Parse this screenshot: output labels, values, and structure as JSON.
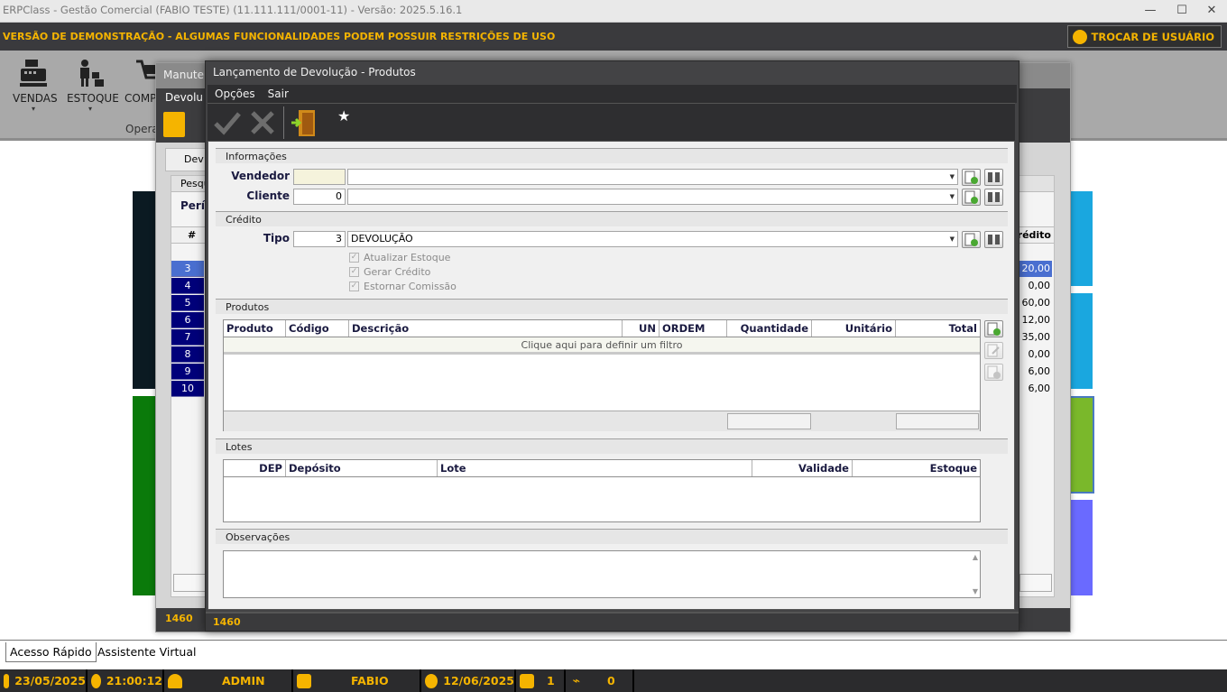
{
  "window": {
    "title": "ERPClass - Gestão Comercial (FABIO TESTE) (11.111.111/0001-11) - Versão: 2025.5.16.1"
  },
  "demo_banner": {
    "message": "VERSÃO DE DEMONSTRAÇÃO - ALGUMAS FUNCIONALIDADES PODEM POSSUIR RESTRIÇÕES DE USO",
    "switch_user": "TROCAR DE USUÁRIO"
  },
  "ribbon": {
    "buttons": [
      {
        "label": "VENDAS"
      },
      {
        "label": "ESTOQUE"
      },
      {
        "label": "COMP"
      }
    ],
    "group_label": "Opera"
  },
  "background_window": {
    "caption": "Manute",
    "menu": "Devolu",
    "tab": "Dev",
    "search_label": "Pesqu",
    "period_label": "Perío",
    "hash_header": "#",
    "credit_header": "rédito",
    "rows": [
      {
        "num": "3",
        "credit": "20,00"
      },
      {
        "num": "4",
        "credit": "0,00"
      },
      {
        "num": "5",
        "credit": "60,00"
      },
      {
        "num": "6",
        "credit": "12,00"
      },
      {
        "num": "7",
        "credit": "35,00"
      },
      {
        "num": "8",
        "credit": "0,00"
      },
      {
        "num": "9",
        "credit": "6,00"
      },
      {
        "num": "10",
        "credit": "6,00"
      }
    ],
    "status": "1460"
  },
  "modal": {
    "title": "Lançamento de Devolução - Produtos",
    "menu": [
      "Opções",
      "Sair"
    ],
    "sections": {
      "informacoes": "Informações",
      "credito": "Crédito",
      "produtos": "Produtos",
      "lotes": "Lotes",
      "observacoes": "Observações"
    },
    "fields": {
      "vendedor_label": "Vendedor",
      "vendedor_code": "",
      "vendedor_name": "",
      "cliente_label": "Cliente",
      "cliente_code": "0",
      "cliente_name": "",
      "tipo_label": "Tipo",
      "tipo_code": "3",
      "tipo_name": "DEVOLUÇÃO"
    },
    "checkboxes": [
      "Atualizar Estoque",
      "Gerar Crédito",
      "Estornar Comissão"
    ],
    "produtos_columns": [
      "Produto",
      "Código",
      "Descrição",
      "UN",
      "ORDEM",
      "Quantidade",
      "Unitário",
      "Total"
    ],
    "produtos_filter": "Clique aqui para definir um filtro",
    "lotes_columns": [
      "DEP",
      "Depósito",
      "Lote",
      "Validade",
      "Estoque"
    ],
    "status": "1460"
  },
  "bottom_tabs": [
    "Acesso Rápido",
    "Assistente Virtual"
  ],
  "statusbar": {
    "date": "23/05/2025",
    "time": "21:00:12",
    "user": "ADMIN",
    "machine": "FABIO",
    "license_date": "12/06/2025",
    "users_count": "1",
    "connections": "0"
  },
  "colors": {
    "accent": "#f5b400",
    "dark_bar": "#3a3a3d",
    "row_selected": "#00007a"
  }
}
